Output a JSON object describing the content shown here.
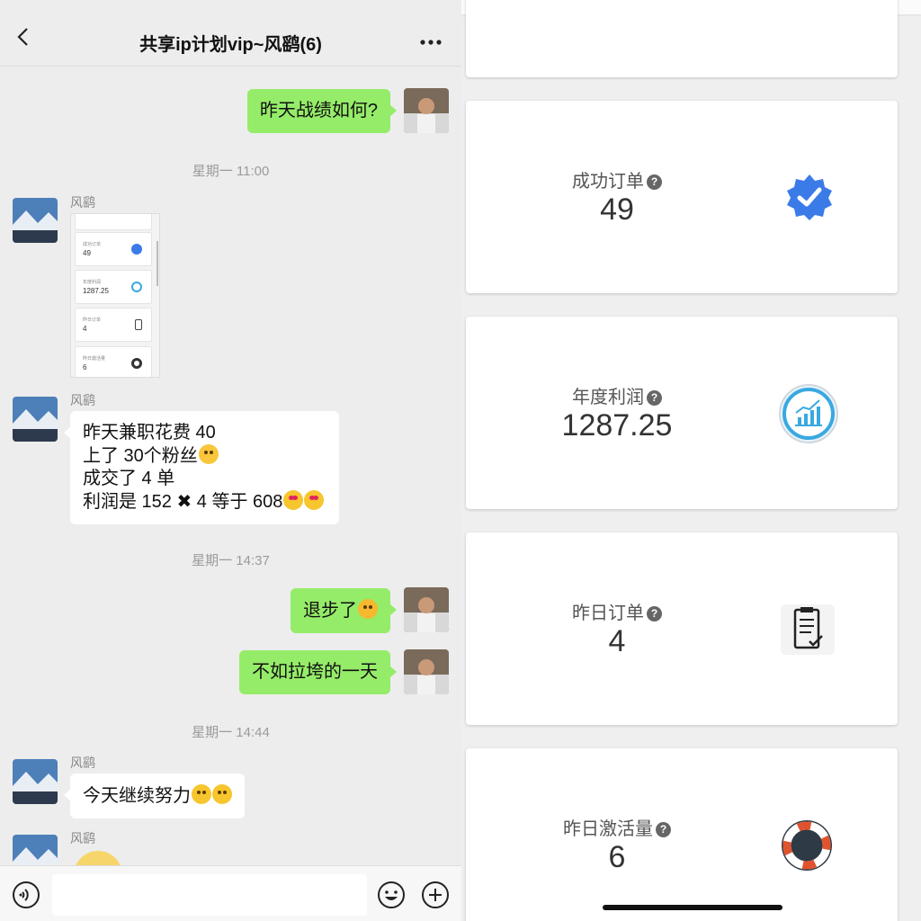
{
  "chat": {
    "title": "共享ip计划vip~风鹞(6)",
    "messages": {
      "m1": "昨天战绩如何?",
      "time1": "星期一 11:00",
      "sender1": "风鹞",
      "sender2": "风鹞",
      "m2_lines": [
        "昨天兼职花费 40",
        "上了 30个粉丝",
        "成交了 4 单",
        "利润是 152 ",
        " 4 等于 608"
      ],
      "time2": "星期一 14:37",
      "m3": "退步了",
      "m4": "不如拉垮的一天",
      "time3": "星期一 14:44",
      "sender3": "风鹞",
      "m5": "今天继续努力",
      "sender4": "风鹞"
    },
    "thumbnail": {
      "cards": [
        {
          "label": "成功订单",
          "value": "49"
        },
        {
          "label": "年度利润",
          "value": "1287.25"
        },
        {
          "label": "昨日订单",
          "value": "4"
        },
        {
          "label": "昨日激活量",
          "value": "6"
        }
      ]
    },
    "icons": [
      "back-icon",
      "more-icon",
      "voice-icon",
      "smile-icon",
      "plus-icon"
    ]
  },
  "stats": {
    "cards": [
      {
        "label": "成功订单",
        "value": "49",
        "icon": "verified-badge-icon",
        "color": "#3b7be8"
      },
      {
        "label": "年度利润",
        "value": "1287.25",
        "icon": "growth-chart-icon",
        "color": "#39a9e0"
      },
      {
        "label": "昨日订单",
        "value": "4",
        "icon": "clipboard-check-icon",
        "color": "#333333"
      },
      {
        "label": "昨日激活量",
        "value": "6",
        "icon": "lifebuoy-icon",
        "color": "#e0532f"
      }
    ]
  },
  "colors": {
    "bubble_green": "#95ec69",
    "chat_bg": "#ededed"
  }
}
